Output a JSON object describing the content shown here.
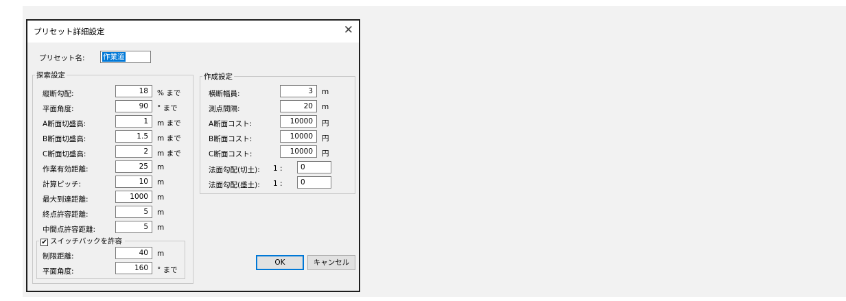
{
  "dialog": {
    "title": "プリセット詳細設定",
    "close_glyph": "✕",
    "preset_name_label": "プリセット名:",
    "preset_name_value": "作業道",
    "search_group": {
      "legend": "探索設定",
      "rows": [
        {
          "label": "縦断勾配:",
          "value": "18",
          "unit": "% まで"
        },
        {
          "label": "平面角度:",
          "value": "90",
          "unit": "° まで"
        },
        {
          "label": "A断面切盛高:",
          "value": "1",
          "unit": "m まで"
        },
        {
          "label": "B断面切盛高:",
          "value": "1.5",
          "unit": "m まで"
        },
        {
          "label": "C断面切盛高:",
          "value": "2",
          "unit": "m まで"
        },
        {
          "label": "作業有効距離:",
          "value": "25",
          "unit": "m"
        },
        {
          "label": "計算ピッチ:",
          "value": "10",
          "unit": "m"
        },
        {
          "label": "最大到達距離:",
          "value": "1000",
          "unit": "m"
        },
        {
          "label": "終点許容距離:",
          "value": "5",
          "unit": "m"
        },
        {
          "label": "中間点許容距離:",
          "value": "5",
          "unit": "m"
        }
      ],
      "switchback": {
        "checkbox_label": "スイッチバックを許容",
        "checked": true,
        "check_glyph": "✔",
        "rows": [
          {
            "label": "制限距離:",
            "value": "40",
            "unit": "m"
          },
          {
            "label": "平面角度:",
            "value": "160",
            "unit": "° まで"
          }
        ]
      }
    },
    "create_group": {
      "legend": "作成設定",
      "rows": [
        {
          "label": "横断幅員:",
          "value": "3",
          "unit": "m"
        },
        {
          "label": "測点間隔:",
          "value": "20",
          "unit": "m"
        },
        {
          "label": "A断面コスト:",
          "value": "10000",
          "unit": "円"
        },
        {
          "label": "B断面コスト:",
          "value": "10000",
          "unit": "円"
        },
        {
          "label": "C断面コスト:",
          "value": "10000",
          "unit": "円"
        }
      ],
      "slopes": [
        {
          "label": "法面勾配(切土):",
          "ratio": "1 :",
          "value": "0"
        },
        {
          "label": "法面勾配(盛土):",
          "ratio": "1 :",
          "value": "0"
        }
      ]
    },
    "buttons": {
      "ok": "OK",
      "cancel": "キャンセル"
    }
  }
}
